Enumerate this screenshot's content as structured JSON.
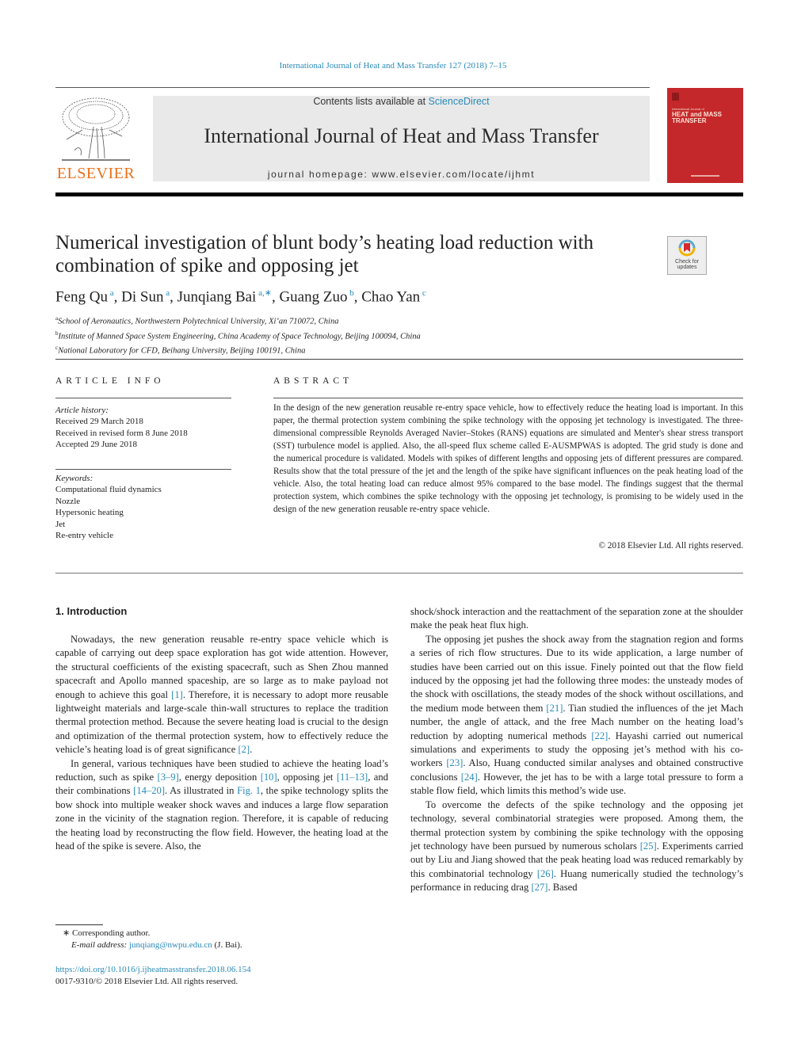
{
  "running_head": "International Journal of Heat and Mass Transfer 127 (2018) 7–15",
  "masthead": {
    "contents_prefix": "Contents lists available at ",
    "contents_link": "ScienceDirect",
    "journal_name": "International Journal of Heat and Mass Transfer",
    "homepage_prefix": "journal homepage: ",
    "homepage_url": "www.elsevier.com/locate/ijhmt"
  },
  "publisher_logo": "ELSEVIER",
  "cover": {
    "small": "International Journal of",
    "title_line1": "HEAT and MASS",
    "title_line2": "TRANSFER",
    "color": "#c5282a"
  },
  "check_updates": {
    "line1": "Check for",
    "line2": "updates"
  },
  "article": {
    "title": "Numerical investigation of blunt body’s heating load reduction with combination of spike and opposing jet",
    "authors": [
      {
        "name": "Feng Qu",
        "sup": "a"
      },
      {
        "name": "Di Sun",
        "sup": "a"
      },
      {
        "name": "Junqiang Bai",
        "sup": "a,∗"
      },
      {
        "name": "Guang Zuo",
        "sup": "b"
      },
      {
        "name": "Chao Yan",
        "sup": "c"
      }
    ],
    "affiliations": [
      {
        "sup": "a",
        "text": "School of Aeronautics, Northwestern Polytechnical University, Xi’an 710072, China"
      },
      {
        "sup": "b",
        "text": "Institute of Manned Space System Engineering, China Academy of Space Technology, Beijing 100094, China"
      },
      {
        "sup": "c",
        "text": "National Laboratory for CFD, Beihang University, Beijing 100191, China"
      }
    ]
  },
  "article_info": {
    "heading": "ARTICLE INFO",
    "history_label": "Article history:",
    "history": [
      "Received 29 March 2018",
      "Received in revised form 8 June 2018",
      "Accepted 29 June 2018"
    ],
    "keywords_label": "Keywords:",
    "keywords": [
      "Computational fluid dynamics",
      "Nozzle",
      "Hypersonic heating",
      "Jet",
      "Re-entry vehicle"
    ]
  },
  "abstract": {
    "heading": "ABSTRACT",
    "text": "In the design of the new generation reusable re-entry space vehicle, how to effectively reduce the heating load is important. In this paper, the thermal protection system combining the spike technology with the opposing jet technology is investigated. The three-dimensional compressible Reynolds Averaged Navier–Stokes (RANS) equations are simulated and Menter's shear stress transport (SST) turbulence model is applied. Also, the all-speed flux scheme called E-AUSMPWAS is adopted. The grid study is done and the numerical procedure is validated. Models with spikes of different lengths and opposing jets of different pressures are compared. Results show that the total pressure of the jet and the length of the spike have significant influences on the peak heating load of the vehicle. Also, the total heating load can reduce almost 95% compared to the base model. The findings suggest that the thermal protection system, which combines the spike technology with the opposing jet technology, is promising to be widely used in the design of the new generation reusable re-entry space vehicle.",
    "copyright": "© 2018 Elsevier Ltd. All rights reserved."
  },
  "body": {
    "section_heading": "1. Introduction",
    "left_paragraphs": [
      [
        {
          "t": "Nowadays, the new generation reusable re-entry space vehicle which is capable of carrying out deep space exploration has got wide attention. However, the structural coefficients of the existing spacecraft, such as Shen Zhou manned spacecraft and Apollo manned spaceship, are so large as to make payload not enough to achieve this goal "
        },
        {
          "ref": "[1]"
        },
        {
          "t": ". Therefore, it is necessary to adopt more reusable lightweight materials and large-scale thin-wall structures to replace the tradition thermal protection method. Because the severe heating load is crucial to the design and optimization of the thermal protection system, how to effectively reduce the vehicle’s heating load is of great significance "
        },
        {
          "ref": "[2]"
        },
        {
          "t": "."
        }
      ],
      [
        {
          "t": "In general, various techniques have been studied to achieve the heating load’s reduction, such as spike "
        },
        {
          "ref": "[3–9]"
        },
        {
          "t": ", energy deposition "
        },
        {
          "ref": "[10]"
        },
        {
          "t": ", opposing jet "
        },
        {
          "ref": "[11–13]"
        },
        {
          "t": ", and their combinations "
        },
        {
          "ref": "[14–20]"
        },
        {
          "t": ". As illustrated in "
        },
        {
          "ref": "Fig. 1"
        },
        {
          "t": ", the spike technology splits the bow shock into multiple weaker shock waves and induces a large flow separation zone in the vicinity of the stagnation region. Therefore, it is capable of reducing the heating load by reconstructing the flow field. However, the heating load at the head of the spike is severe. Also, the"
        }
      ]
    ],
    "right_paragraphs": [
      [
        {
          "t": "shock/shock interaction and the reattachment of the separation zone at the shoulder make the peak heat flux high."
        }
      ],
      [
        {
          "t": "The opposing jet pushes the shock away from the stagnation region and forms a series of rich flow structures. Due to its wide application, a large number of studies have been carried out on this issue. Finely pointed out that the flow field induced by the opposing jet had the following three modes: the unsteady modes of the shock with oscillations, the steady modes of the shock without oscillations, and the medium mode between them "
        },
        {
          "ref": "[21]"
        },
        {
          "t": ". Tian studied the influences of the jet Mach number, the angle of attack, and the free Mach number on the heating load’s reduction by adopting numerical methods "
        },
        {
          "ref": "[22]"
        },
        {
          "t": ". Hayashi carried out numerical simulations and experiments to study the opposing jet’s method with his co-workers "
        },
        {
          "ref": "[23]"
        },
        {
          "t": ". Also, Huang conducted similar analyses and obtained constructive conclusions "
        },
        {
          "ref": "[24]"
        },
        {
          "t": ". However, the jet has to be with a large total pressure to form a stable flow field, which limits this method’s wide use."
        }
      ],
      [
        {
          "t": "To overcome the defects of the spike technology and the opposing jet technology, several combinatorial strategies were proposed. Among them, the thermal protection system by combining the spike technology with the opposing jet technology have been pursued by numerous scholars "
        },
        {
          "ref": "[25]"
        },
        {
          "t": ". Experiments carried out by Liu and Jiang showed that the peak heating load was reduced remarkably by this combinatorial technology "
        },
        {
          "ref": "[26]"
        },
        {
          "t": ". Huang numerically studied the technology’s performance in reducing drag "
        },
        {
          "ref": "[27]"
        },
        {
          "t": ". Based"
        }
      ]
    ]
  },
  "footnote": {
    "star": "∗",
    "corresponding": "Corresponding author.",
    "email_label": "E-mail address:",
    "email": "junqiang@nwpu.edu.cn",
    "email_suffix": " (J. Bai)."
  },
  "doi": {
    "url": "https://doi.org/10.1016/j.ijheatmasstransfer.2018.06.154",
    "issn_line": "0017-9310/© 2018 Elsevier Ltd. All rights reserved."
  },
  "colors": {
    "link": "#2a8ab8",
    "elsevier_orange": "#e9711c",
    "masthead_bg": "#e9e9e9"
  }
}
